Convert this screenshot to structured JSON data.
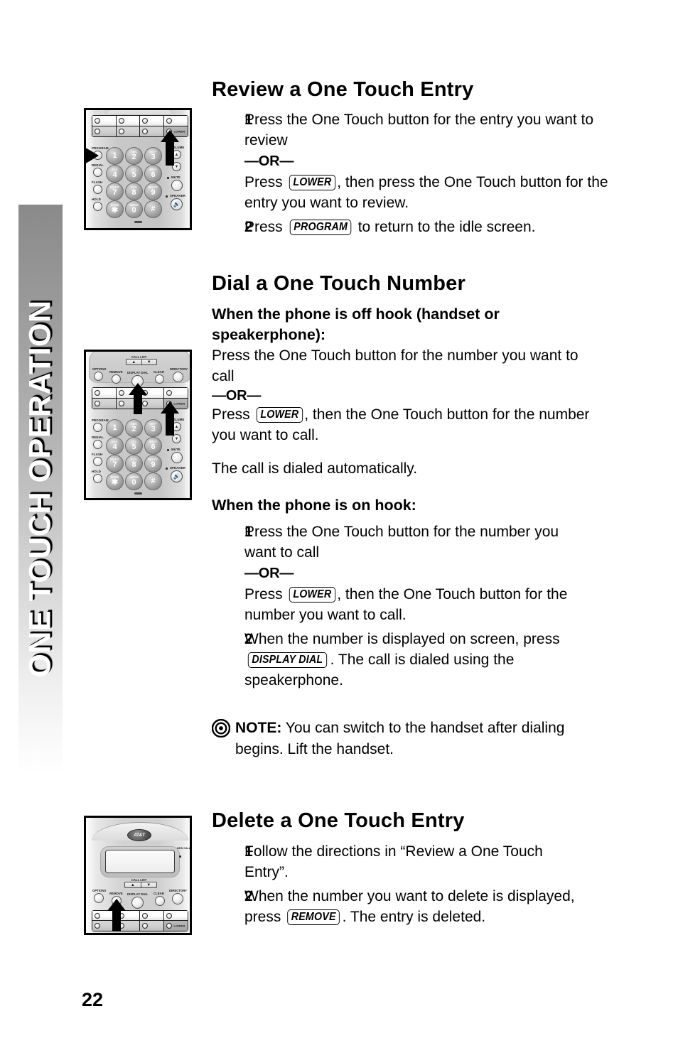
{
  "sidebar": {
    "tab_label": "ONE TOUCH OPERATION"
  },
  "page": {
    "number": "22"
  },
  "sections": [
    {
      "id": "review",
      "heading": "Review a One Touch Entry",
      "steps": [
        {
          "num": "1",
          "line1": "Press the One Touch button for the entry you want to review",
          "or": "—OR—",
          "line2_pre": "Press ",
          "key": "LOWER",
          "line2_post": ", then press the One Touch button for the entry you want to review."
        },
        {
          "num": "2",
          "pre": "Press ",
          "key": "PROGRAM",
          "post": " to return to the idle screen."
        }
      ]
    },
    {
      "id": "dial",
      "heading": "Dial a One Touch Number",
      "sub_offhook": "When the phone is off hook (handset or speakerphone):",
      "offhook_p1": "Press the One Touch button for the number you want to call",
      "offhook_or": "—OR—",
      "offhook_p2_pre": "Press ",
      "offhook_p2_key": "LOWER",
      "offhook_p2_post": ", then the One Touch button for the number you want to call.",
      "offhook_p3": "The call is dialed automatically.",
      "sub_onhook": "When the phone is on hook:",
      "onhook_steps": [
        {
          "num": "1",
          "line1": "Press the One Touch button for the number you want to call",
          "or": "—OR—",
          "line2_pre": "Press ",
          "key": "LOWER",
          "line2_post": ", then the One Touch button for the number you want to call."
        },
        {
          "num": "2",
          "pre": "When the number is displayed on screen, press ",
          "key": "DISPLAY DIAL",
          "post": ".  The call is dialed using the speakerphone."
        }
      ]
    },
    {
      "id": "note",
      "label": "NOTE:",
      "text": "You can switch to the handset after dialing begins.  Lift the handset.",
      "icon": "bullseye-icon"
    },
    {
      "id": "delete",
      "heading": "Delete a One Touch Entry",
      "steps": [
        {
          "num": "1",
          "text": "Follow the directions in “Review a One Touch Entry”."
        },
        {
          "num": "2",
          "pre": "When the number you want to delete is displayed, press ",
          "key": "REMOVE",
          "post": ".  The entry is deleted."
        }
      ]
    }
  ],
  "figures": {
    "fig1": {
      "caption_hidden": "Phone keypad with arrows to PROGRAM and LOWER",
      "one_touch_lower_label": "LOWER",
      "left_buttons": [
        "PROGRAM",
        "REDIAL",
        "FLASH",
        "HOLD"
      ],
      "right_buttons": [
        "VOLUME",
        "MUTE",
        "SPEAKER"
      ],
      "keys": [
        {
          "sub": "",
          "big": "1"
        },
        {
          "sub": "ABC",
          "big": "2"
        },
        {
          "sub": "DEF",
          "big": "3"
        },
        {
          "sub": "GHI",
          "big": "4"
        },
        {
          "sub": "JKL",
          "big": "5"
        },
        {
          "sub": "MNO",
          "big": "6"
        },
        {
          "sub": "PQRS",
          "big": "7"
        },
        {
          "sub": "TUV",
          "big": "8"
        },
        {
          "sub": "WXYZ",
          "big": "9"
        },
        {
          "sub": "TONE",
          "big": "✱"
        },
        {
          "sub": "OPER",
          "big": "0"
        },
        {
          "sub": "",
          "big": "#"
        }
      ]
    },
    "fig2": {
      "deck_buttons": [
        "OPTIONS",
        "REMOVE",
        "DISPLAY DIAL",
        "CLEAR",
        "DIRECTORY"
      ],
      "callid_label": "CALL LIST",
      "one_touch_lower_label": "LOWER"
    },
    "fig3": {
      "brand": "AT&T",
      "deck_buttons": [
        "OPTIONS",
        "REMOVE",
        "DISPLAY DIAL",
        "CLEAR",
        "DIRECTORY"
      ],
      "callid_label": "CALL LIST",
      "one_touch_lower_label": "LOWER",
      "indicator_label": "NEW CALL"
    }
  }
}
